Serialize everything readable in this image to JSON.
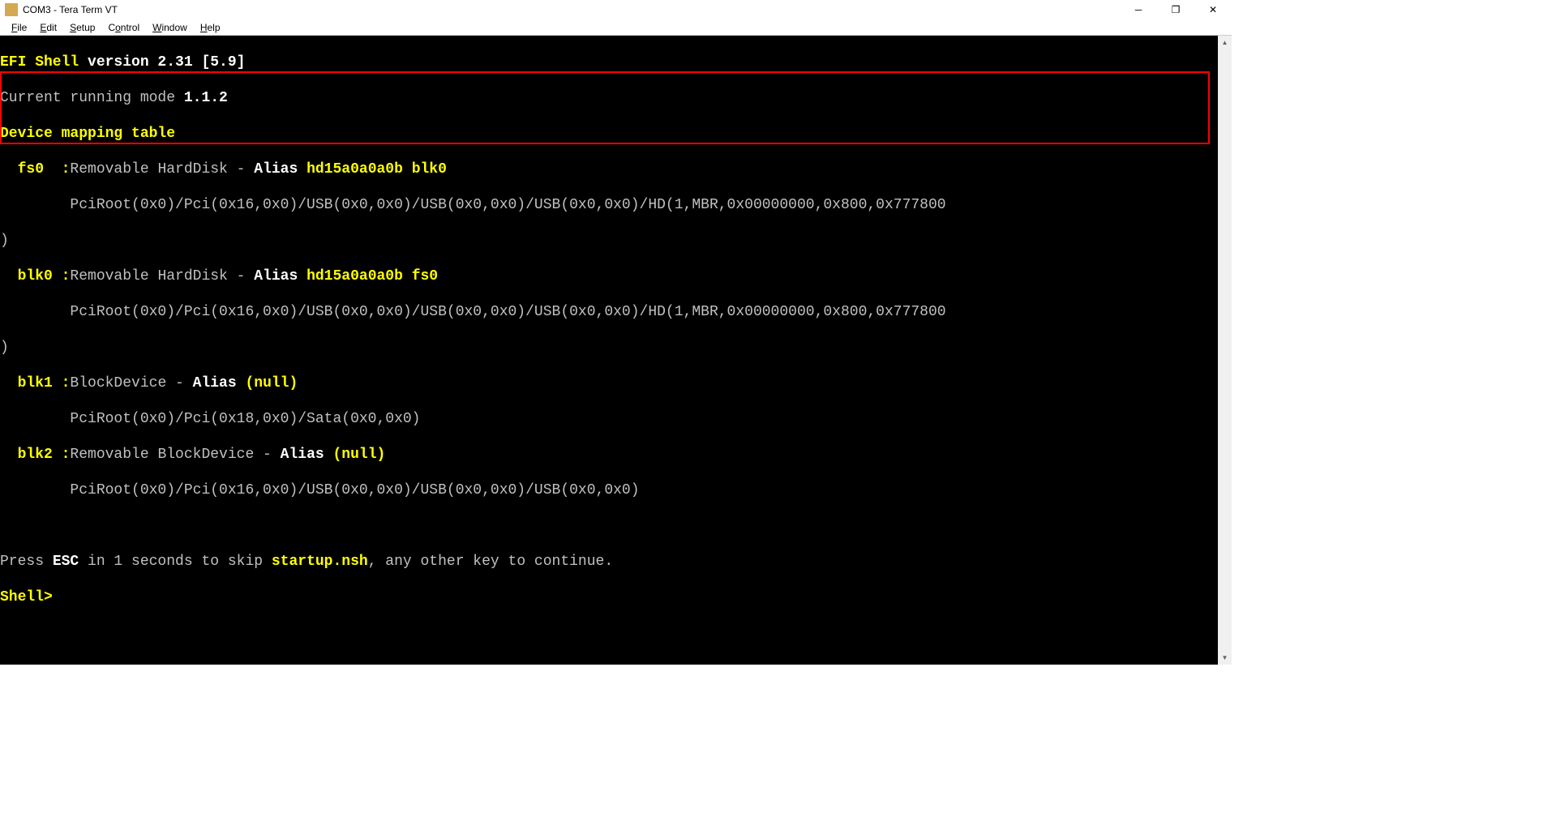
{
  "titlebar": {
    "title": "COM3 - Tera Term VT"
  },
  "menubar": {
    "items": [
      "File",
      "Edit",
      "Setup",
      "Control",
      "Window",
      "Help"
    ]
  },
  "terminal": {
    "shell_label": "EFI Shell",
    "version_text": " version 2.31 [5.9]",
    "running_mode_label": "Current running mode ",
    "running_mode_value": "1.1.2",
    "mapping_header": "Device mapping table",
    "fs0_label": "  fs0  :",
    "fs0_desc": "Removable HardDisk - ",
    "alias_label": "Alias ",
    "fs0_alias": "hd15a0a0a0b blk0",
    "fs0_path": "        PciRoot(0x0)/Pci(0x16,0x0)/USB(0x0,0x0)/USB(0x0,0x0)/USB(0x0,0x0)/HD(1,MBR,0x00000000,0x800,0x777800",
    "close_paren": ")",
    "blk0_label": "  blk0 :",
    "blk0_desc": "Removable HardDisk - ",
    "blk0_alias": "hd15a0a0a0b fs0",
    "blk0_path": "        PciRoot(0x0)/Pci(0x16,0x0)/USB(0x0,0x0)/USB(0x0,0x0)/USB(0x0,0x0)/HD(1,MBR,0x00000000,0x800,0x777800",
    "blk1_label": "  blk1 :",
    "blk1_desc": "BlockDevice - ",
    "blk1_alias": "(null)",
    "blk1_path": "        PciRoot(0x0)/Pci(0x18,0x0)/Sata(0x0,0x0)",
    "blk2_label": "  blk2 :",
    "blk2_desc": "Removable BlockDevice - ",
    "blk2_alias": "(null)",
    "blk2_path": "        PciRoot(0x0)/Pci(0x16,0x0)/USB(0x0,0x0)/USB(0x0,0x0)/USB(0x0,0x0)",
    "press_text1": "Press ",
    "esc_text": "ESC",
    "press_text2": " in 1 seconds to skip ",
    "startup_text": "startup.nsh",
    "press_text3": ", any other key to continue.",
    "prompt": "Shell>"
  }
}
